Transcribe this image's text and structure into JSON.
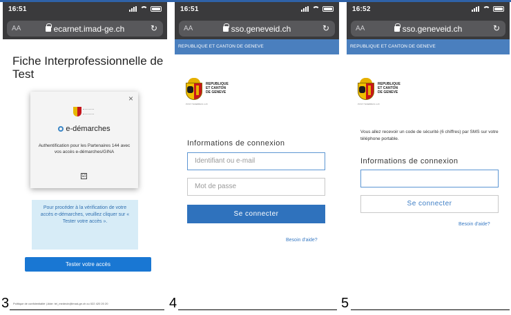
{
  "screens": [
    {
      "time": "16:51",
      "url": "ecarnet.imad-ge.ch",
      "aa": "AA",
      "title": "Fiche Interprofessionnelle de Test",
      "modal": {
        "close": "×",
        "brand": "e-démarches",
        "text": "Authentification pour les Partenaires 144 avec vos accès e-démarches/GINA",
        "checkbox": "☑"
      },
      "info": "Pour procéder à la vérification de votre accès e-démarches, veuillez cliquer sur « Tester votre accès ».",
      "button": "Tester votre accès"
    },
    {
      "time": "16:51",
      "url": "sso.geneveid.ch",
      "aa": "AA",
      "banner": "REPUBLIQUE ET CANTON DE GENEVE",
      "crest_lines": [
        "REPUBLIQUE",
        "ET CANTON",
        "DE GENEVE"
      ],
      "crest_motto": "POST TENEBRAS LUX",
      "login_title": "Informations de connexion",
      "username_placeholder": "Identifiant ou e-mail",
      "password_placeholder": "Mot de passe",
      "connect": "Se connecter",
      "help": "Besoin d'aide?"
    },
    {
      "time": "16:52",
      "url": "sso.geneveid.ch",
      "aa": "AA",
      "banner": "REPUBLIQUE ET CANTON DE GENEVE",
      "crest_lines": [
        "REPUBLIQUE",
        "ET CANTON",
        "DE GENEVE"
      ],
      "crest_motto": "POST TENEBRAS LUX",
      "message": "Vous allez recevoir un code de sécurité (6 chiffres) par SMS sur votre téléphone portable.",
      "login_title": "Informations de connexion",
      "code_value": "",
      "connect": "Se connecter",
      "help": "Besoin d'aide?"
    }
  ],
  "steps": [
    "3",
    "4",
    "5"
  ],
  "footer": "Politique de confidentialité | Aide: tel_medecin@imad-ge.ch ou 022 420 20 20",
  "colors": {
    "banner": "#4a7fbe",
    "primary": "#2f72bd",
    "test_button": "#1977d3",
    "info_bg": "#d7ecf7"
  }
}
